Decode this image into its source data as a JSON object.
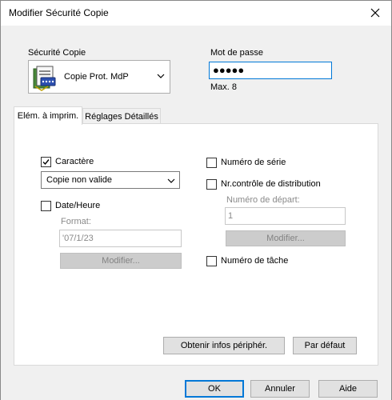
{
  "window": {
    "title": "Modifier Sécurité Copie"
  },
  "security": {
    "label": "Sécurité Copie",
    "value": "Copie Prot. MdP"
  },
  "password": {
    "label": "Mot de passe",
    "value": "●●●●●",
    "hint": "Max. 8"
  },
  "tabs": [
    {
      "label": "Elém. à imprim."
    },
    {
      "label": "Réglages Détaillés"
    }
  ],
  "left": {
    "caractere_label": "Caractère",
    "caractere_checked": true,
    "caractere_value": "Copie non valide",
    "date_label": "Date/Heure",
    "date_checked": false,
    "format_label": "Format:",
    "format_value": "'07/1/23",
    "modify_label": "Modifier..."
  },
  "right": {
    "serial_label": "Numéro de série",
    "distribution_label": "Nr.contrôle de distribution",
    "start_label": "Numéro de départ:",
    "start_value": "1",
    "modify_label": "Modifier...",
    "job_label": "Numéro de tâche"
  },
  "panel_buttons": {
    "device_info": "Obtenir infos périphér.",
    "default": "Par défaut"
  },
  "footer": {
    "ok": "OK",
    "cancel": "Annuler",
    "help": "Aide"
  },
  "colors": {
    "focus_border": "#0078d7",
    "dialog_bg": "#f0f0f0"
  }
}
